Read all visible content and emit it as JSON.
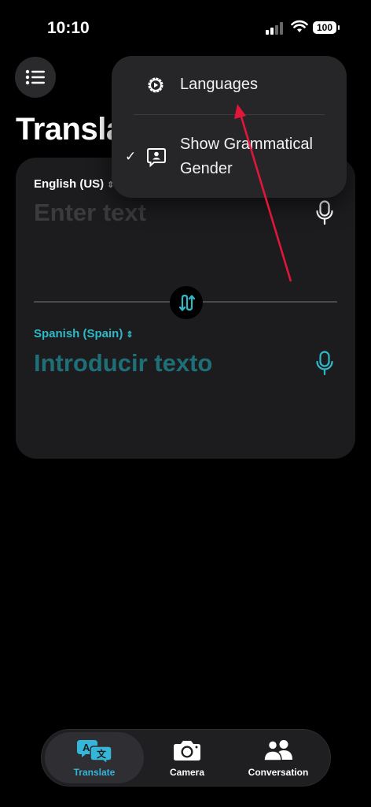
{
  "status": {
    "time": "10:10",
    "battery": "100"
  },
  "header": {
    "title": "Translate"
  },
  "source": {
    "language": "English (US)",
    "placeholder": "Enter text"
  },
  "target": {
    "language": "Spanish (Spain)",
    "placeholder": "Introducir texto"
  },
  "menu": {
    "items": [
      {
        "label": "Languages",
        "icon": "gear-play-icon",
        "checked": false
      },
      {
        "label_line1": "Show Grammatical",
        "label_line2": "Gender",
        "icon": "person-bubble-icon",
        "checked": true
      }
    ]
  },
  "tabs": [
    {
      "label": "Translate",
      "icon": "translate-icon",
      "active": true
    },
    {
      "label": "Camera",
      "icon": "camera-icon",
      "active": false
    },
    {
      "label": "Conversation",
      "icon": "people-icon",
      "active": false
    }
  ],
  "colors": {
    "accent": "#2fb9c8",
    "arrow": "#e0163a"
  }
}
